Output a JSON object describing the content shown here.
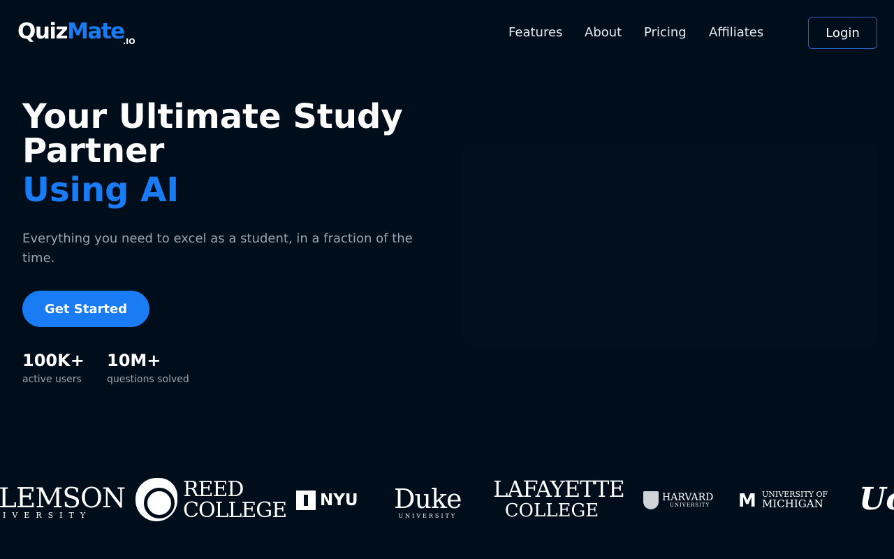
{
  "header": {
    "logo": {
      "word1": "Quiz",
      "word2": "Mate",
      "suffix": ".IO"
    },
    "nav": [
      {
        "label": "Features"
      },
      {
        "label": "About"
      },
      {
        "label": "Pricing"
      },
      {
        "label": "Affiliates"
      }
    ],
    "login_label": "Login"
  },
  "hero": {
    "title": "Your Ultimate Study Partner",
    "accent": "Using AI",
    "subtitle": "Everything you need to excel as a student, in a fraction of the time.",
    "cta_label": "Get Started",
    "stats": [
      {
        "value": "100K+",
        "label": "active users"
      },
      {
        "value": "10M+",
        "label": "questions solved"
      }
    ]
  },
  "universities": {
    "clemson": {
      "big": "LEMSON",
      "small": "IVERSITY"
    },
    "reed": {
      "line1": "REED",
      "line2": "COLLEGE"
    },
    "nyu": {
      "name": "NYU"
    },
    "duke": {
      "big": "Duke",
      "small": "UNIVERSITY"
    },
    "lafayette": {
      "line1": "LAFAYETTE",
      "line2": "COLLEGE"
    },
    "harvard": {
      "line1": "HARVARD",
      "line2": "UNIVERSITY"
    },
    "michigan": {
      "line1": "UNIVERSITY OF",
      "line2": "MICHIGAN"
    },
    "ucla": {
      "name": "Ucl"
    }
  },
  "colors": {
    "background": "#000d1a",
    "accent": "#1a7cf5",
    "muted_text": "#9aa3b1",
    "login_border": "#2f5fc9"
  }
}
